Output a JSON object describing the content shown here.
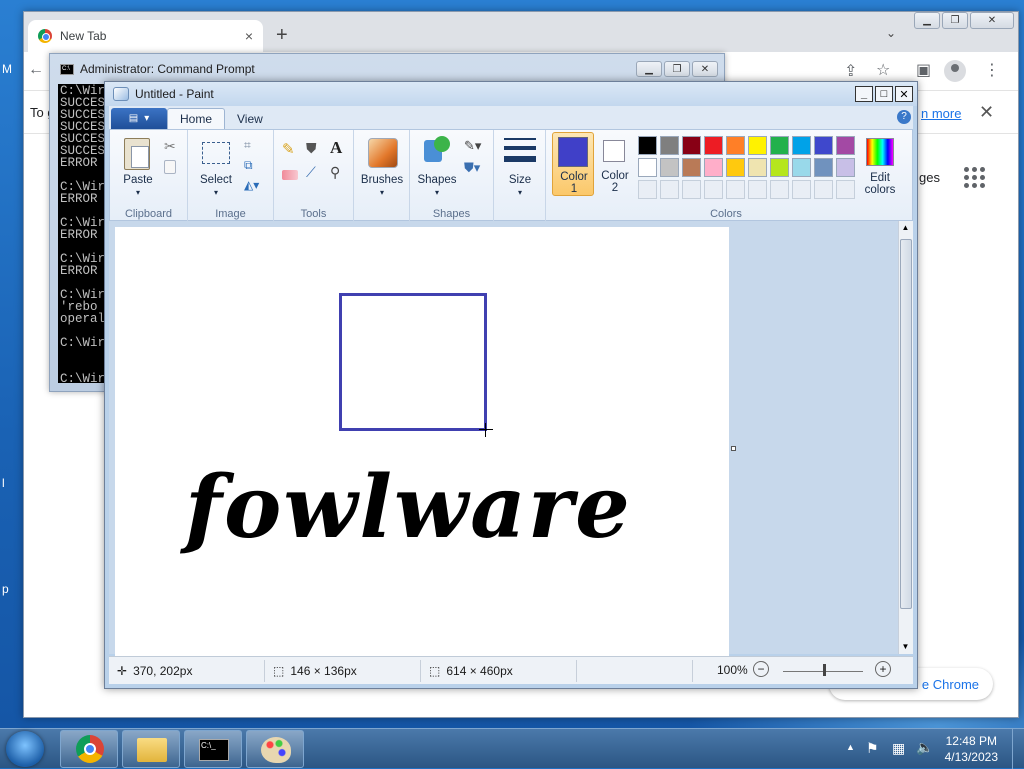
{
  "chrome": {
    "tab_title": "New Tab",
    "tab_close": "×",
    "new_tab": "+",
    "tab_dropdown": "⌄",
    "infobar_text": "To g",
    "learn_more": "n more",
    "info_close": "✕",
    "images": "ges",
    "bottom_pill": "e Chrome"
  },
  "cmd": {
    "title": "Administrator: Command Prompt",
    "lines": "C:\\Wir\nSUCCES\nSUCCES\nSUCCES\nSUCCES\nSUCCES\nERROR\n\nC:\\Wir\nERROR\n\nC:\\Wir\nERROR\n\nC:\\Wir\nERROR\n\nC:\\Wir\n'rebo\noperal\n\nC:\\Wir\n\n\nC:\\Wir"
  },
  "paint": {
    "title": "Untitled - Paint",
    "tabs": {
      "home": "Home",
      "view": "View"
    },
    "help": "?",
    "groups": {
      "clipboard": "Clipboard",
      "image": "Image",
      "tools": "Tools",
      "shapes": "Shapes",
      "colors": "Colors"
    },
    "tools": {
      "paste": "Paste",
      "select": "Select",
      "brushes": "Brushes",
      "shapes": "Shapes",
      "size": "Size",
      "color1_l1": "Color",
      "color1_l2": "1",
      "color2_l1": "Color",
      "color2_l2": "2",
      "edit_l1": "Edit",
      "edit_l2": "colors",
      "text_tool": "A"
    },
    "color1": "#4040c8",
    "color2": "#ffffff",
    "palette_row1": [
      "#000000",
      "#7f7f7f",
      "#880015",
      "#ed1c24",
      "#ff7f27",
      "#fff200",
      "#22b14c",
      "#00a2e8",
      "#3f48cc",
      "#a349a4"
    ],
    "palette_row2": [
      "#ffffff",
      "#c3c3c3",
      "#b97a57",
      "#ffaec9",
      "#ffc90e",
      "#efe4b0",
      "#b5e61d",
      "#99d9ea",
      "#7092be",
      "#c8bfe7"
    ],
    "canvas_text": "fowlware",
    "status": {
      "cursor": "370, 202px",
      "selection": "146 × 136px",
      "size": "614 × 460px",
      "zoom": "100%",
      "zoom_out": "−",
      "zoom_in": "+"
    }
  },
  "taskbar": {
    "time": "12:48 PM",
    "date": "4/13/2023",
    "tray_arrow": "▲"
  }
}
